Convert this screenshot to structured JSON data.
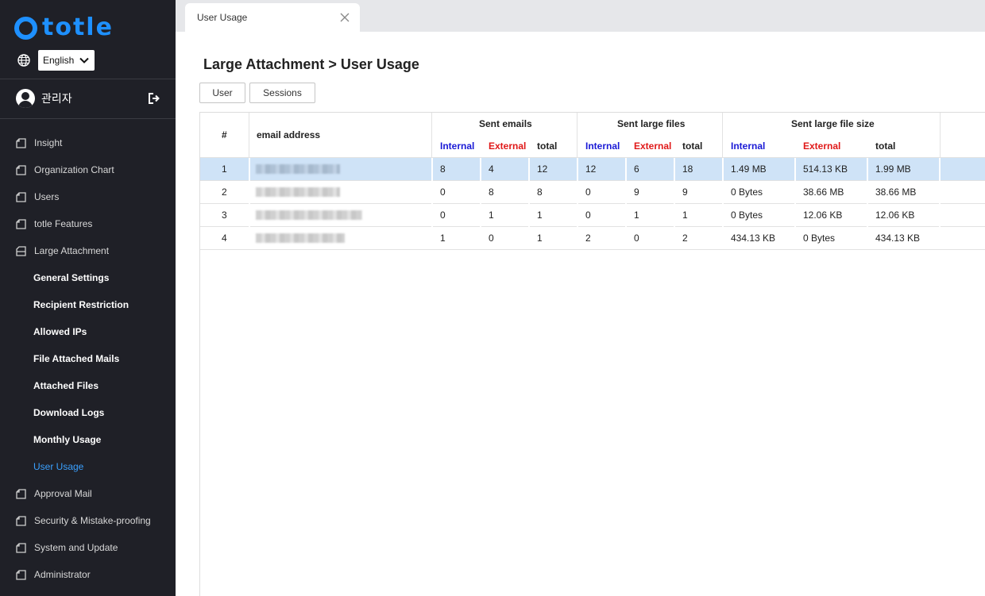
{
  "app": {
    "logo_text": "totle",
    "brand_color": "#1e90ff"
  },
  "language": {
    "selected": "English"
  },
  "user": {
    "name": "관리자"
  },
  "nav": {
    "items_top": [
      {
        "label": "Insight"
      },
      {
        "label": "Organization Chart"
      },
      {
        "label": "Users"
      },
      {
        "label": "totle Features"
      },
      {
        "label": "Large Attachment"
      }
    ],
    "sub_items": [
      {
        "label": "General Settings"
      },
      {
        "label": "Recipient Restriction"
      },
      {
        "label": "Allowed IPs"
      },
      {
        "label": "File Attached Mails"
      },
      {
        "label": "Attached Files"
      },
      {
        "label": "Download Logs"
      },
      {
        "label": "Monthly Usage"
      },
      {
        "label": "User Usage",
        "active": true
      }
    ],
    "items_bottom": [
      {
        "label": "Approval Mail"
      },
      {
        "label": "Security & Mistake-proofing"
      },
      {
        "label": "System and Update"
      },
      {
        "label": "Administrator"
      }
    ]
  },
  "tab": {
    "label": "User Usage"
  },
  "page": {
    "title": "Large Attachment > User Usage"
  },
  "buttons": {
    "user": "User",
    "sessions": "Sessions"
  },
  "table": {
    "col_index": "#",
    "col_email": "email address",
    "groups": [
      "Sent emails",
      "Sent large files",
      "Sent large file size"
    ],
    "sub_internal": "Internal",
    "sub_external": "External",
    "sub_total": "total",
    "rows": [
      {
        "index": "1",
        "email": "",
        "emails": [
          "8",
          "4",
          "12"
        ],
        "files": [
          "12",
          "6",
          "18"
        ],
        "size": [
          "1.49 MB",
          "514.13 KB",
          "1.99 MB"
        ]
      },
      {
        "index": "2",
        "email": "",
        "emails": [
          "0",
          "8",
          "8"
        ],
        "files": [
          "0",
          "9",
          "9"
        ],
        "size": [
          "0 Bytes",
          "38.66 MB",
          "38.66 MB"
        ]
      },
      {
        "index": "3",
        "email": "",
        "emails": [
          "0",
          "1",
          "1"
        ],
        "files": [
          "0",
          "1",
          "1"
        ],
        "size": [
          "0 Bytes",
          "12.06 KB",
          "12.06 KB"
        ]
      },
      {
        "index": "4",
        "email": "",
        "emails": [
          "1",
          "0",
          "1"
        ],
        "files": [
          "2",
          "0",
          "2"
        ],
        "size": [
          "434.13 KB",
          "0 Bytes",
          "434.13 KB"
        ]
      }
    ]
  },
  "colors": {
    "internal": "#1a1ad6",
    "external": "#e01919",
    "selected_row": "#cfe3f7",
    "active_nav": "#3aa0ff"
  }
}
